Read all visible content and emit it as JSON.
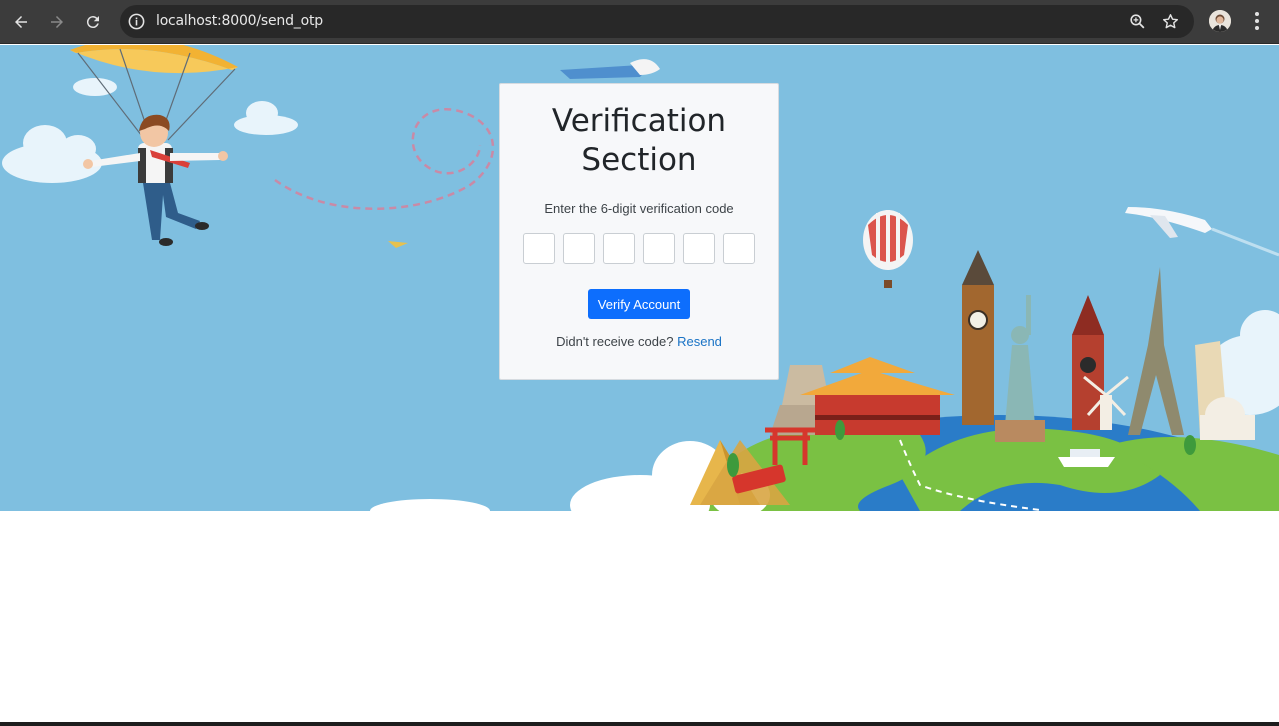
{
  "browser": {
    "url": "localhost:8000/send_otp",
    "icons": [
      "back-icon",
      "forward-icon",
      "reload-icon",
      "site-info-icon",
      "zoom-icon",
      "bookmark-star-icon",
      "profile-avatar",
      "menu-kebab-icon"
    ]
  },
  "verification": {
    "title_line1": "Verification",
    "title_line2": "Section",
    "instruction": "Enter the 6-digit verification code",
    "otp_digits": [
      "",
      "",
      "",
      "",
      "",
      ""
    ],
    "verify_label": "Verify Account",
    "resend_prompt": "Didn't receive code?",
    "resend_link": "Resend"
  },
  "colors": {
    "sky": "#7fbfe0",
    "primary_button": "#0d6efd",
    "link": "#1a73c5",
    "chrome": "#3c3c3c"
  }
}
